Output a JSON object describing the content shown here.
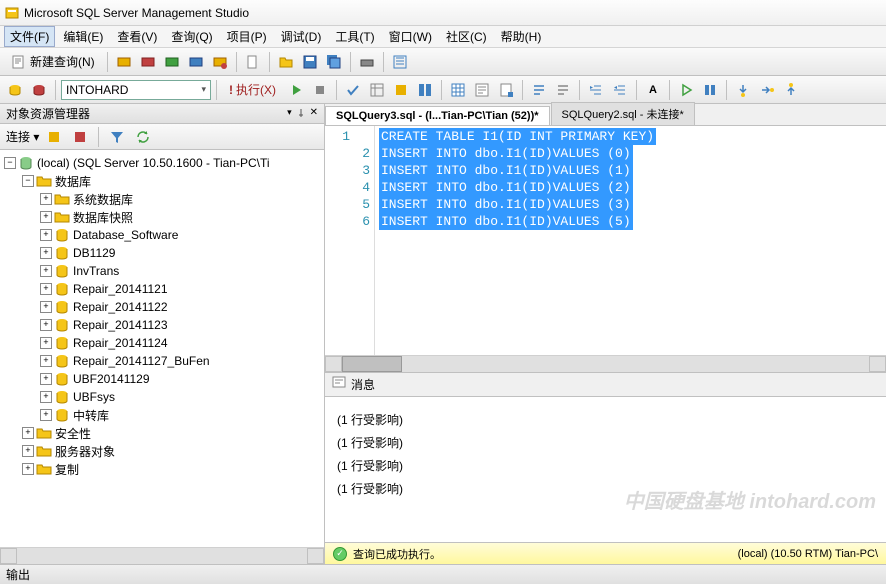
{
  "title": "Microsoft SQL Server Management Studio",
  "menu": [
    "文件(F)",
    "编辑(E)",
    "查看(V)",
    "查询(Q)",
    "项目(P)",
    "调试(D)",
    "工具(T)",
    "窗口(W)",
    "社区(C)",
    "帮助(H)"
  ],
  "newQuery": "新建查询(N)",
  "dbCombo": "INTOHARD",
  "execute": "执行(X)",
  "objectExplorer": {
    "title": "对象资源管理器",
    "connect": "连接 ▾",
    "root": "(local) (SQL Server 10.50.1600 - Tian-PC\\Ti",
    "databases": "数据库",
    "sysdb": "系统数据库",
    "snapshot": "数据库快照",
    "dbs": [
      "Database_Software",
      "DB1129",
      "InvTrans",
      "Repair_20141121",
      "Repair_20141122",
      "Repair_20141123",
      "Repair_20141124",
      "Repair_20141127_BuFen",
      "UBF20141129",
      "UBFsys",
      "中转库"
    ],
    "security": "安全性",
    "serverobj": "服务器对象",
    "replication": "复制"
  },
  "tabs": [
    {
      "label": "SQLQuery3.sql - (l...Tian-PC\\Tian (52))*",
      "active": true
    },
    {
      "label": "SQLQuery2.sql - 未连接*",
      "active": false
    }
  ],
  "code": [
    "CREATE TABLE I1(ID INT PRIMARY KEY)",
    "INSERT INTO dbo.I1(ID)VALUES (0)",
    "INSERT INTO dbo.I1(ID)VALUES (1)",
    "INSERT INTO dbo.I1(ID)VALUES (2)",
    "INSERT INTO dbo.I1(ID)VALUES (3)",
    "INSERT INTO dbo.I1(ID)VALUES (5)"
  ],
  "messages": {
    "tab": "消息",
    "lines": [
      "(1 行受影响)",
      "(1 行受影响)",
      "(1 行受影响)",
      "(1 行受影响)"
    ]
  },
  "status": {
    "ok": "查询已成功执行。",
    "right": "(local) (10.50 RTM)   Tian-PC\\"
  },
  "output": "输出",
  "watermark": "中国硬盘基地 intohard.com"
}
